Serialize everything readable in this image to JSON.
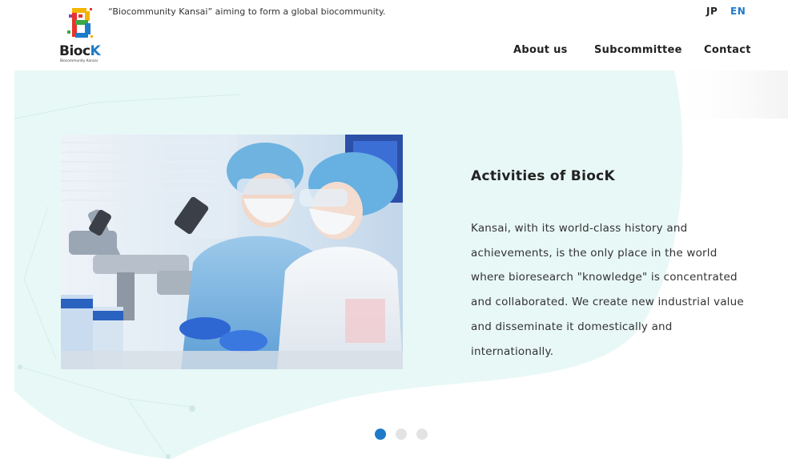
{
  "header": {
    "tagline": "“Biocommunity Kansai” aiming to form a global biocommunity.",
    "logo": {
      "name_main": "Bioc",
      "name_accent": "K",
      "subtitle": "Biocommunity Kansai",
      "mark": "B"
    },
    "languages": [
      {
        "label": "JP",
        "active": false
      },
      {
        "label": "EN",
        "active": true
      }
    ],
    "nav": [
      {
        "label": "About us"
      },
      {
        "label": "Subcommittee"
      },
      {
        "label": "Contact"
      }
    ]
  },
  "hero": {
    "title": "Activities of BiocK",
    "text_lines": [
      "Kansai, with its world-class history and",
      "achievements, is the only place in the world",
      "where bioresearch \"knowledge\" is concentrated",
      "and collaborated. We create new industrial value",
      "and disseminate it domestically and",
      "internationally."
    ],
    "slide_count": 3,
    "active_slide": 1
  },
  "colors": {
    "accent": "#1f7ac9",
    "hero_bg": "#e8f8f6",
    "text": "#333333"
  }
}
